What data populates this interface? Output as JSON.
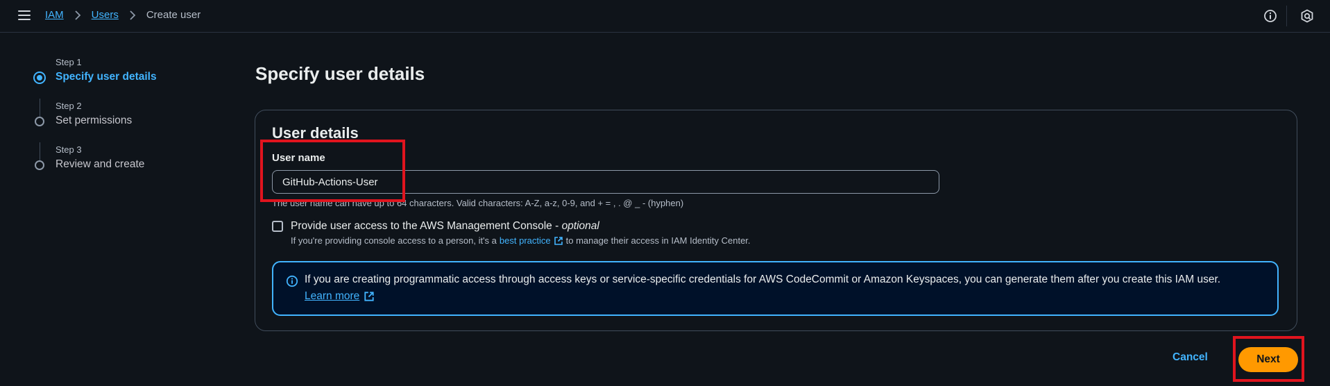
{
  "breadcrumb": {
    "items": [
      "IAM",
      "Users"
    ],
    "current": "Create user"
  },
  "stepper": {
    "steps": [
      {
        "num": "Step 1",
        "label": "Specify user details",
        "state": "active"
      },
      {
        "num": "Step 2",
        "label": "Set permissions",
        "state": "inactive"
      },
      {
        "num": "Step 3",
        "label": "Review and create",
        "state": "inactive"
      }
    ]
  },
  "main": {
    "title": "Specify user details",
    "card": {
      "title": "User details",
      "username_label": "User name",
      "username_value": "GitHub-Actions-User",
      "username_hint": "The user name can have up to 64 characters. Valid characters: A-Z, a-z, 0-9, and + = , . @ _ - (hyphen)",
      "console_access": {
        "label": "Provide user access to the AWS Management Console - ",
        "optional": "optional",
        "checked": false,
        "desc_before": "If you're providing console access to a person, it's a",
        "desc_link": "best practice",
        "desc_after": "to manage their access in IAM Identity Center."
      },
      "info_alert": {
        "text": "If you are creating programmatic access through access keys or service-specific credentials for AWS CodeCommit or Amazon Keyspaces, you can generate them after you create this IAM user.",
        "link": "Learn more"
      }
    }
  },
  "footer": {
    "cancel_label": "Cancel",
    "next_label": "Next"
  },
  "colors": {
    "background": "#0f141a",
    "link": "#42b4ff",
    "primary_button": "#ff9900",
    "highlight": "#e0141e"
  },
  "icons": {
    "menu": "hamburger-menu-icon",
    "info": "info-circle-icon",
    "notifications": "notification-icon",
    "external": "external-link-icon"
  }
}
